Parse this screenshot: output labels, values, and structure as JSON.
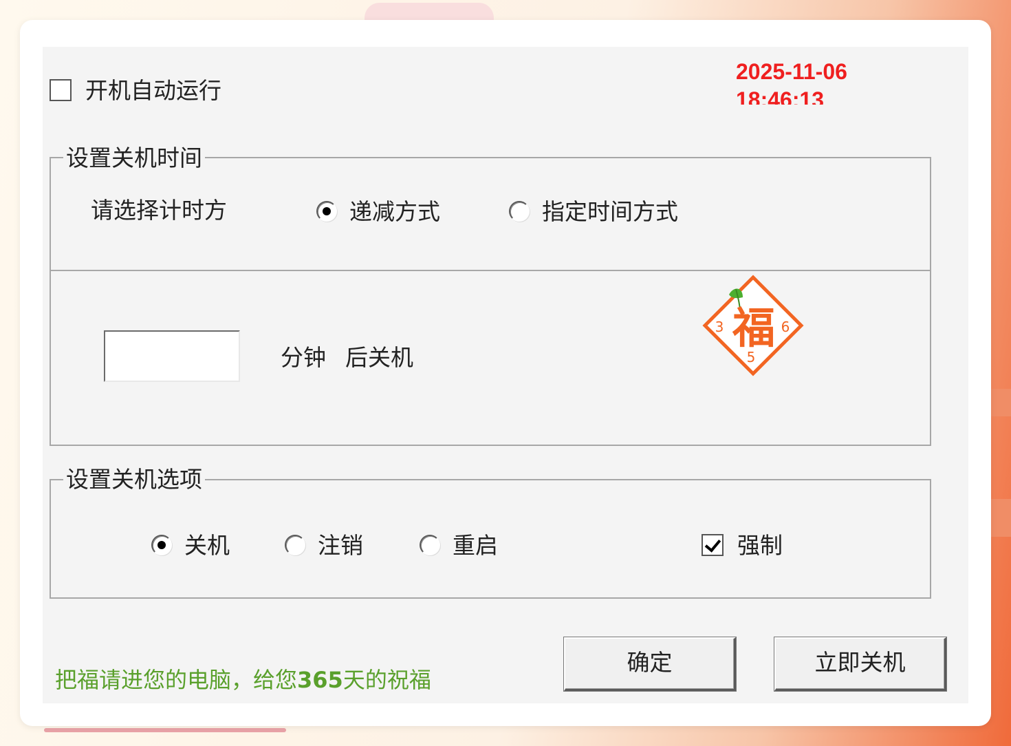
{
  "autostart": {
    "label": "开机自动运行",
    "checked": false
  },
  "clock": {
    "date": "2025-11-06",
    "time": "18:46:13",
    "color": "#ef1f1f"
  },
  "shutdown_time": {
    "legend": "设置关机时间",
    "mode_prompt": "请选择计时方",
    "modes": [
      {
        "label": "递减方式",
        "selected": true
      },
      {
        "label": "指定时间方式",
        "selected": false
      }
    ],
    "minutes_value": "",
    "unit_label": "分钟",
    "after_label": "后关机"
  },
  "logo": {
    "icon": "fu-blessing-logo",
    "text": "福",
    "left_digit": "3",
    "right_digit": "6",
    "bottom_digit": "5",
    "color": "#f26522",
    "leaf_color": "#4caf30"
  },
  "shutdown_options": {
    "legend": "设置关机选项",
    "actions": [
      {
        "label": "关机",
        "selected": true
      },
      {
        "label": "注销",
        "selected": false
      },
      {
        "label": "重启",
        "selected": false
      }
    ],
    "force": {
      "label": "强制",
      "checked": true
    }
  },
  "footer": {
    "prefix": "把福请进您的电脑，给您",
    "number": "365",
    "suffix": "天的祝福",
    "color": "#5aa02c"
  },
  "buttons": {
    "ok": "确定",
    "shutdown_now": "立即关机"
  }
}
